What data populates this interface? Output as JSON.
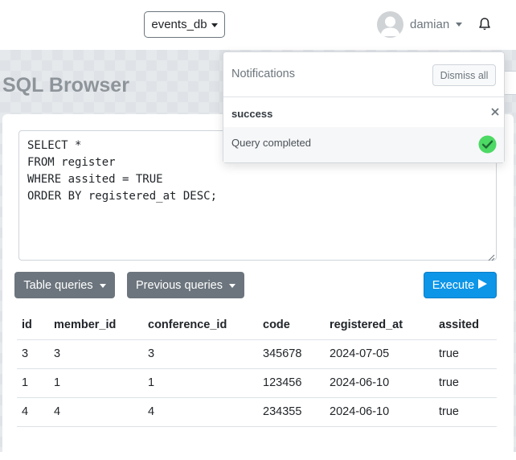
{
  "navbar": {
    "database": "events_db",
    "user": "damian",
    "icons": {
      "avatar": "user-avatar-icon",
      "bell": "bell-icon",
      "caret": "caret-down-icon"
    }
  },
  "page": {
    "title": "SQL Browser"
  },
  "editor": {
    "query": "SELECT *\nFROM register\nWHERE assited = TRUE\nORDER BY registered_at DESC;"
  },
  "toolbar": {
    "table_queries_label": "Table queries",
    "previous_queries_label": "Previous queries",
    "execute_label": "Execute",
    "execute_icon": "play-icon"
  },
  "results": {
    "columns": [
      "id",
      "member_id",
      "conference_id",
      "code",
      "registered_at",
      "assited"
    ],
    "rows": [
      [
        "3",
        "3",
        "3",
        "345678",
        "2024-07-05",
        "true"
      ],
      [
        "1",
        "1",
        "1",
        "123456",
        "2024-06-10",
        "true"
      ],
      [
        "4",
        "4",
        "4",
        "234355",
        "2024-06-10",
        "true"
      ]
    ]
  },
  "notifications": {
    "title": "Notifications",
    "dismiss_all_label": "Dismiss all",
    "items": [
      {
        "type": "success",
        "message": "Query completed",
        "icon": "check-circle-icon"
      }
    ]
  },
  "colors": {
    "primary": "#0d95e8",
    "secondary": "#6c757d",
    "success": "#4cd964",
    "title_gray": "#8d949a"
  }
}
